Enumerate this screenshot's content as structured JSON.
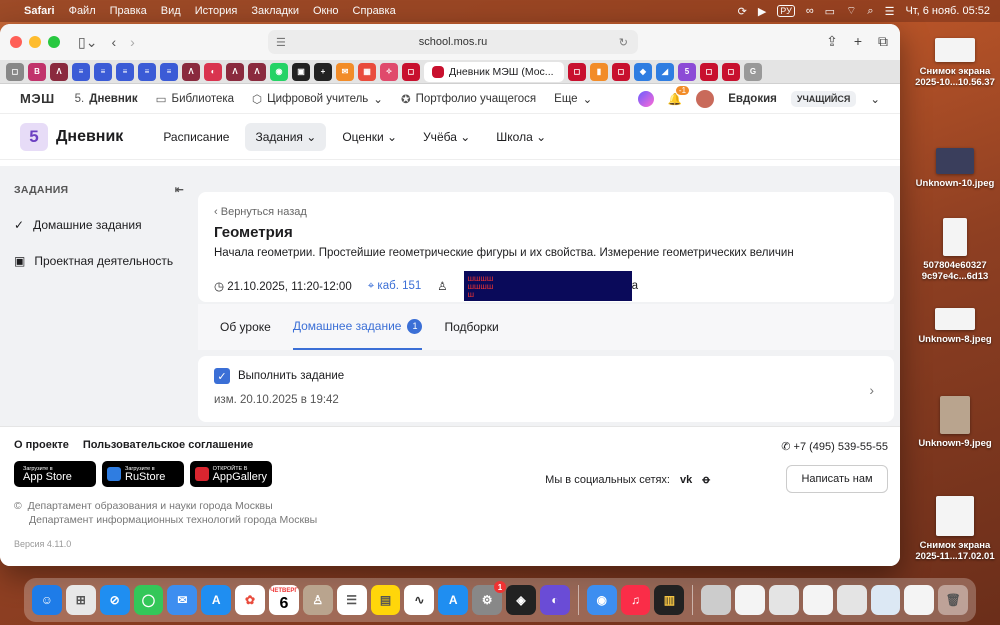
{
  "menubar": {
    "app": "Safari",
    "items": [
      "Файл",
      "Правка",
      "Вид",
      "История",
      "Закладки",
      "Окно",
      "Справка"
    ],
    "input_lang": "РУ",
    "datetime": "Чт, 6 нояб.  05:52"
  },
  "desktop": {
    "items": [
      {
        "label": "Снимок экрана 2025-10...10.56.37"
      },
      {
        "label": "Unknown-10.jpeg"
      },
      {
        "label": "507804e60327 9c97e4c...6d13"
      },
      {
        "label": "Unknown-8.jpeg"
      },
      {
        "label": "Unknown-9.jpeg"
      },
      {
        "label": "Снимок экрана 2025-11...17.02.01"
      }
    ]
  },
  "browser": {
    "url": "school.mos.ru",
    "active_tab": "Дневник МЭШ (Мос..."
  },
  "site": {
    "logo": "МЭШ",
    "nav": [
      "Дневник",
      "Библиотека",
      "Цифровой учитель",
      "Портфолио учащегося",
      "Еще"
    ],
    "notif_count": "-1",
    "user_name": "Евдокия",
    "user_role": "УЧАЩИЙСЯ"
  },
  "app": {
    "logo_digit": "5",
    "title": "Дневник",
    "nav": [
      "Расписание",
      "Задания",
      "Оценки",
      "Учёба",
      "Школа"
    ]
  },
  "sidebar": {
    "header": "ЗАДАНИЯ",
    "links": [
      "Домашние задания",
      "Проектная деятельность"
    ]
  },
  "lesson": {
    "back": "Вернуться назад",
    "title": "Геометрия",
    "subtitle": "Начала геометрии. Простейшие геометрические фигуры и их свойства. Измерение геометрических величин",
    "datetime": "21.10.2025, 11:20-12:00",
    "room": "каб. 151",
    "teacher_tail": "а"
  },
  "tabs": {
    "items": [
      "Об уроке",
      "Домашнее задание",
      "Подборки"
    ],
    "hw_count": "1"
  },
  "homework": {
    "task": "Выполнить задание",
    "modified": "изм. 20.10.2025 в 19:42"
  },
  "footer": {
    "links": [
      "О проекте",
      "Пользовательское соглашение"
    ],
    "phone": "+7 (495) 539-55-55",
    "stores": [
      {
        "small": "Загрузите в",
        "big": "App Store"
      },
      {
        "small": "Загрузите в",
        "big": "RuStore"
      },
      {
        "small": "ОТКРОЙТЕ В",
        "big": "AppGallery"
      }
    ],
    "social_label": "Мы в социальных сетях:",
    "write_button": "Написать нам",
    "dept1": "Департамент образования и науки города Москвы",
    "dept2": "Департамент информационных технологий города Москвы",
    "version": "Версия 4.11.0"
  },
  "dock": {
    "calendar_month": "ЧЕТВЕРГ",
    "calendar_day": "6",
    "badge": "1"
  }
}
